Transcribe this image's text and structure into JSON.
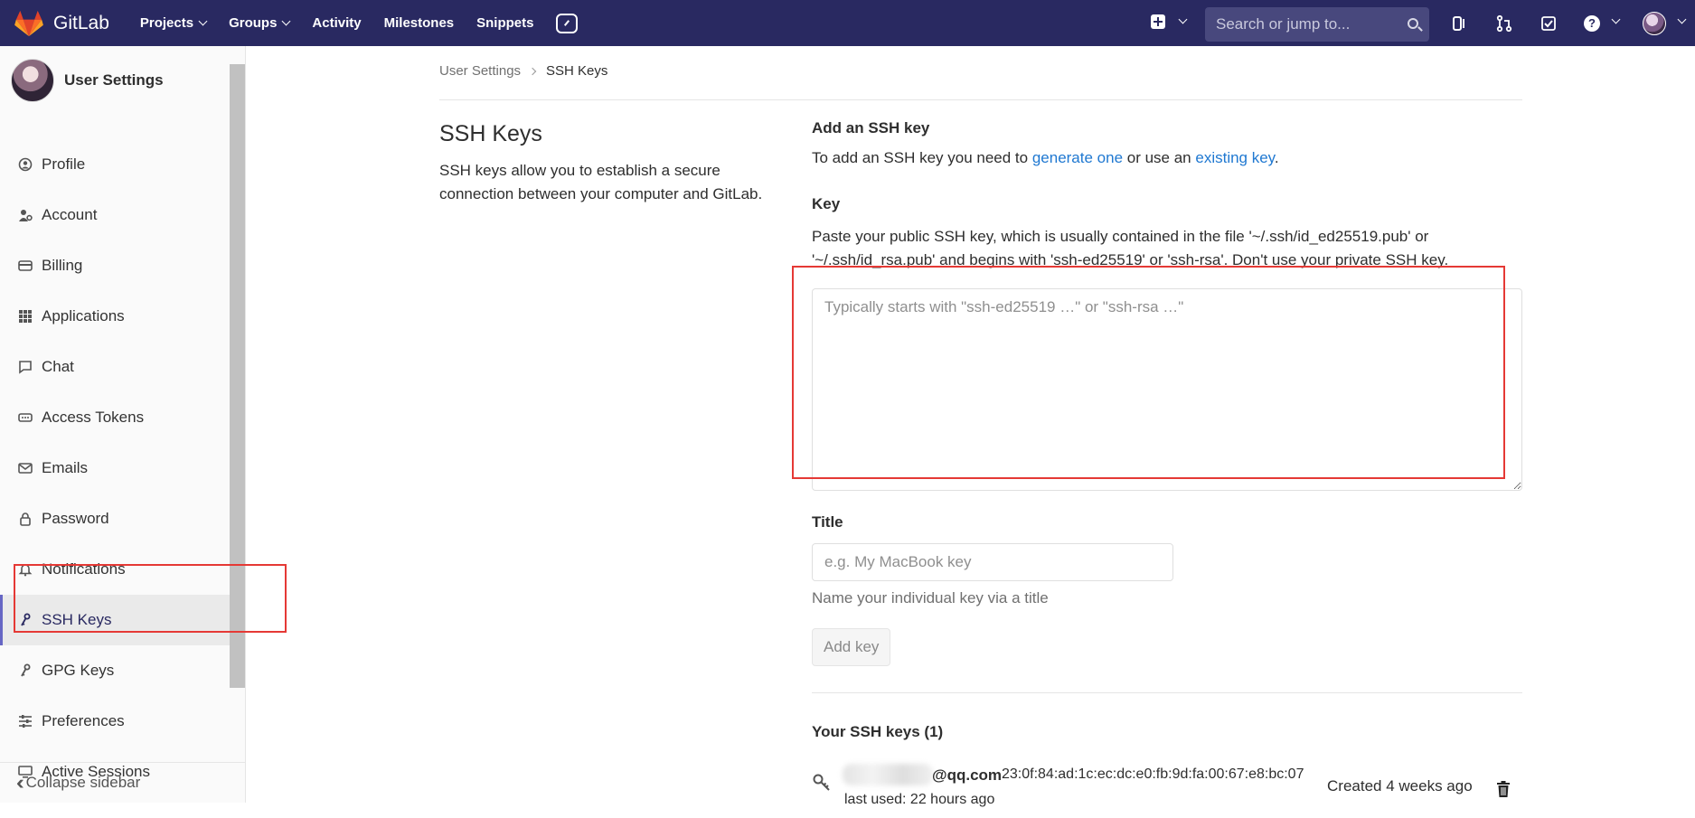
{
  "navbar": {
    "logo_text": "GitLab",
    "links": [
      {
        "label": "Projects",
        "dropdown": true
      },
      {
        "label": "Groups",
        "dropdown": true
      },
      {
        "label": "Activity",
        "dropdown": false
      },
      {
        "label": "Milestones",
        "dropdown": false
      },
      {
        "label": "Snippets",
        "dropdown": false
      }
    ],
    "search_placeholder": "Search or jump to...",
    "help_glyph": "?"
  },
  "sidebar": {
    "title": "User Settings",
    "items": [
      {
        "label": "Profile",
        "icon": "profile-icon"
      },
      {
        "label": "Account",
        "icon": "account-icon"
      },
      {
        "label": "Billing",
        "icon": "billing-icon"
      },
      {
        "label": "Applications",
        "icon": "applications-icon"
      },
      {
        "label": "Chat",
        "icon": "chat-icon"
      },
      {
        "label": "Access Tokens",
        "icon": "token-icon"
      },
      {
        "label": "Emails",
        "icon": "mail-icon"
      },
      {
        "label": "Password",
        "icon": "lock-icon"
      },
      {
        "label": "Notifications",
        "icon": "bell-icon"
      },
      {
        "label": "SSH Keys",
        "icon": "key-icon",
        "active": true
      },
      {
        "label": "GPG Keys",
        "icon": "key-icon"
      },
      {
        "label": "Preferences",
        "icon": "preferences-icon"
      },
      {
        "label": "Active Sessions",
        "icon": "monitor-icon"
      }
    ],
    "collapse_label": "Collapse sidebar"
  },
  "breadcrumb": {
    "parent": "User Settings",
    "current": "SSH Keys"
  },
  "page": {
    "title": "SSH Keys",
    "description": "SSH keys allow you to establish a secure connection between your computer and GitLab."
  },
  "form": {
    "heading": "Add an SSH key",
    "intro_prefix": "To add an SSH key you need to ",
    "intro_link1": "generate one",
    "intro_middle": " or use an ",
    "intro_link2": "existing key",
    "intro_suffix": ".",
    "key_label": "Key",
    "key_help": "Paste your public SSH key, which is usually contained in the file '~/.ssh/id_ed25519.pub' or '~/.ssh/id_rsa.pub' and begins with 'ssh-ed25519' or 'ssh-rsa'. Don't use your private SSH key.",
    "key_placeholder": "Typically starts with \"ssh-ed25519 …\" or \"ssh-rsa …\"",
    "title_label": "Title",
    "title_placeholder": "e.g. My MacBook key",
    "title_help": "Name your individual key via a title",
    "add_button": "Add key"
  },
  "keys": {
    "heading": "Your SSH keys (1)",
    "list": [
      {
        "email": "@qq.com",
        "fingerprint": "23:0f:84:ad:1c:ec:dc:e0:fb:9d:fa:00:67:e8:bc:07",
        "last_used": "last used: 22 hours ago",
        "created": "Created 4 weeks ago"
      }
    ]
  },
  "colors": {
    "navbar": "#292961",
    "link": "#1f78d1",
    "annotation": "#e53935"
  }
}
